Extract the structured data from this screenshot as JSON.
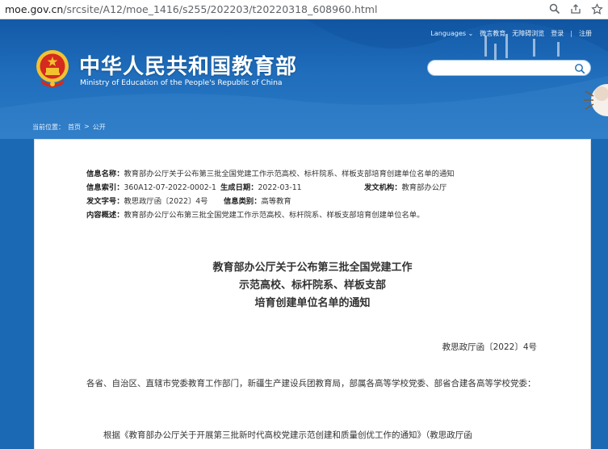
{
  "browser": {
    "url_host": "moe.gov.cn",
    "url_path": "/srcsite/A12/moe_1416/s255/202203/t20220318_608960.html",
    "icons": [
      "zoom-icon",
      "share-icon",
      "bookmark-star-icon"
    ]
  },
  "header": {
    "site_name_cn": "中华人民共和国教育部",
    "site_name_en": "Ministry of Education of the People's Republic of China",
    "top_links": {
      "languages": "Languages",
      "mobile": "微言教育",
      "accessible": "无障碍浏览",
      "login": "登录",
      "separator": "|",
      "register": "注册"
    },
    "search_placeholder": ""
  },
  "breadcrumb": {
    "current_label": "当前位置：",
    "home": "首页",
    "sep": ">",
    "section": "公开"
  },
  "info": {
    "name_label": "信息名称：",
    "name_value": "教育部办公厅关于公布第三批全国党建工作示范高校、标杆院系、样板支部培育创建单位名单的通知",
    "index_label": "信息索引：",
    "index_value": "360A12-07-2022-0002-1",
    "date_label": "生成日期：",
    "date_value": "2022-03-11",
    "issuer_label": "发文机构：",
    "issuer_value": "教育部办公厅",
    "docno_label": "发文字号：",
    "docno_value": "教思政厅函〔2022〕4号",
    "category_label": "信息类别：",
    "category_value": "高等教育",
    "summary_label": "内容概述：",
    "summary_value": "教育部办公厅公布第三批全国党建工作示范高校、标杆院系、样板支部培育创建单位名单。"
  },
  "article": {
    "title_line1": "教育部办公厅关于公布第三批全国党建工作",
    "title_line2": "示范高校、标杆院系、样板支部",
    "title_line3": "培育创建单位名单的通知",
    "doc_number": "教思政厅函〔2022〕4号",
    "para1": "各省、自治区、直辖市党委教育工作部门，新疆生产建设兵团教育局，部属各高等学校党委、部省合建各高等学校党委：",
    "para2": "根据《教育部办公厅关于开展第三批新时代高校党建示范创建和质量创优工作的通知》（教思政厅函"
  },
  "colors": {
    "header_blue": "#1b69b4",
    "emblem_red": "#d42a1f",
    "emblem_gold": "#f2c230",
    "text": "#333333"
  }
}
